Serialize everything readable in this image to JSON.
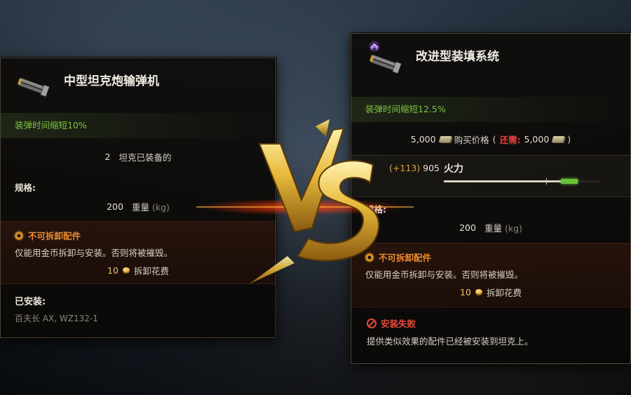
{
  "left_panel": {
    "title": "中型坦克炮输弹机",
    "effect": "装弹时间缩短10%",
    "tanks_equipped_count": "2",
    "tanks_equipped_label": "坦克已装备的",
    "specs_label": "规格:",
    "weight_value": "200",
    "weight_label": "重量",
    "weight_unit": "(kg)",
    "nonremovable_title": "不可拆卸配件",
    "nonremovable_desc": "仅能用金币拆卸与安装。否则将被摧毁。",
    "demount_cost": "10",
    "demount_label": "拆卸花费",
    "installed_label": "已安装:",
    "installed_value": "百夫长 AX, WZ132-1"
  },
  "right_panel": {
    "title": "改进型装填系统",
    "effect": "装弹时间缩短12.5%",
    "price_value": "5,000",
    "price_label": "购买价格",
    "need_label": "还需:",
    "need_value": "5,000",
    "firepower_delta": "(+113)",
    "firepower_value": "905",
    "firepower_label": "火力",
    "firepower_fill": 0.86,
    "firepower_bonus_fill": 0.11,
    "specs_label": "规格:",
    "weight_value": "200",
    "weight_label": "重量",
    "weight_unit": "(kg)",
    "nonremovable_title": "不可拆卸配件",
    "nonremovable_desc": "仅能用金币拆卸与安装。否则将被摧毁。",
    "demount_cost": "10",
    "demount_label": "拆卸花费",
    "fail_title": "安装失败",
    "fail_desc": "提供类似效果的配件已经被安装到坦克上。"
  },
  "vs_text": "VS",
  "colors": {
    "effect_green": "#7fc342",
    "warning_orange": "#ec8a2e",
    "error_red": "#e84a3a",
    "gold": "#e8c86a"
  }
}
